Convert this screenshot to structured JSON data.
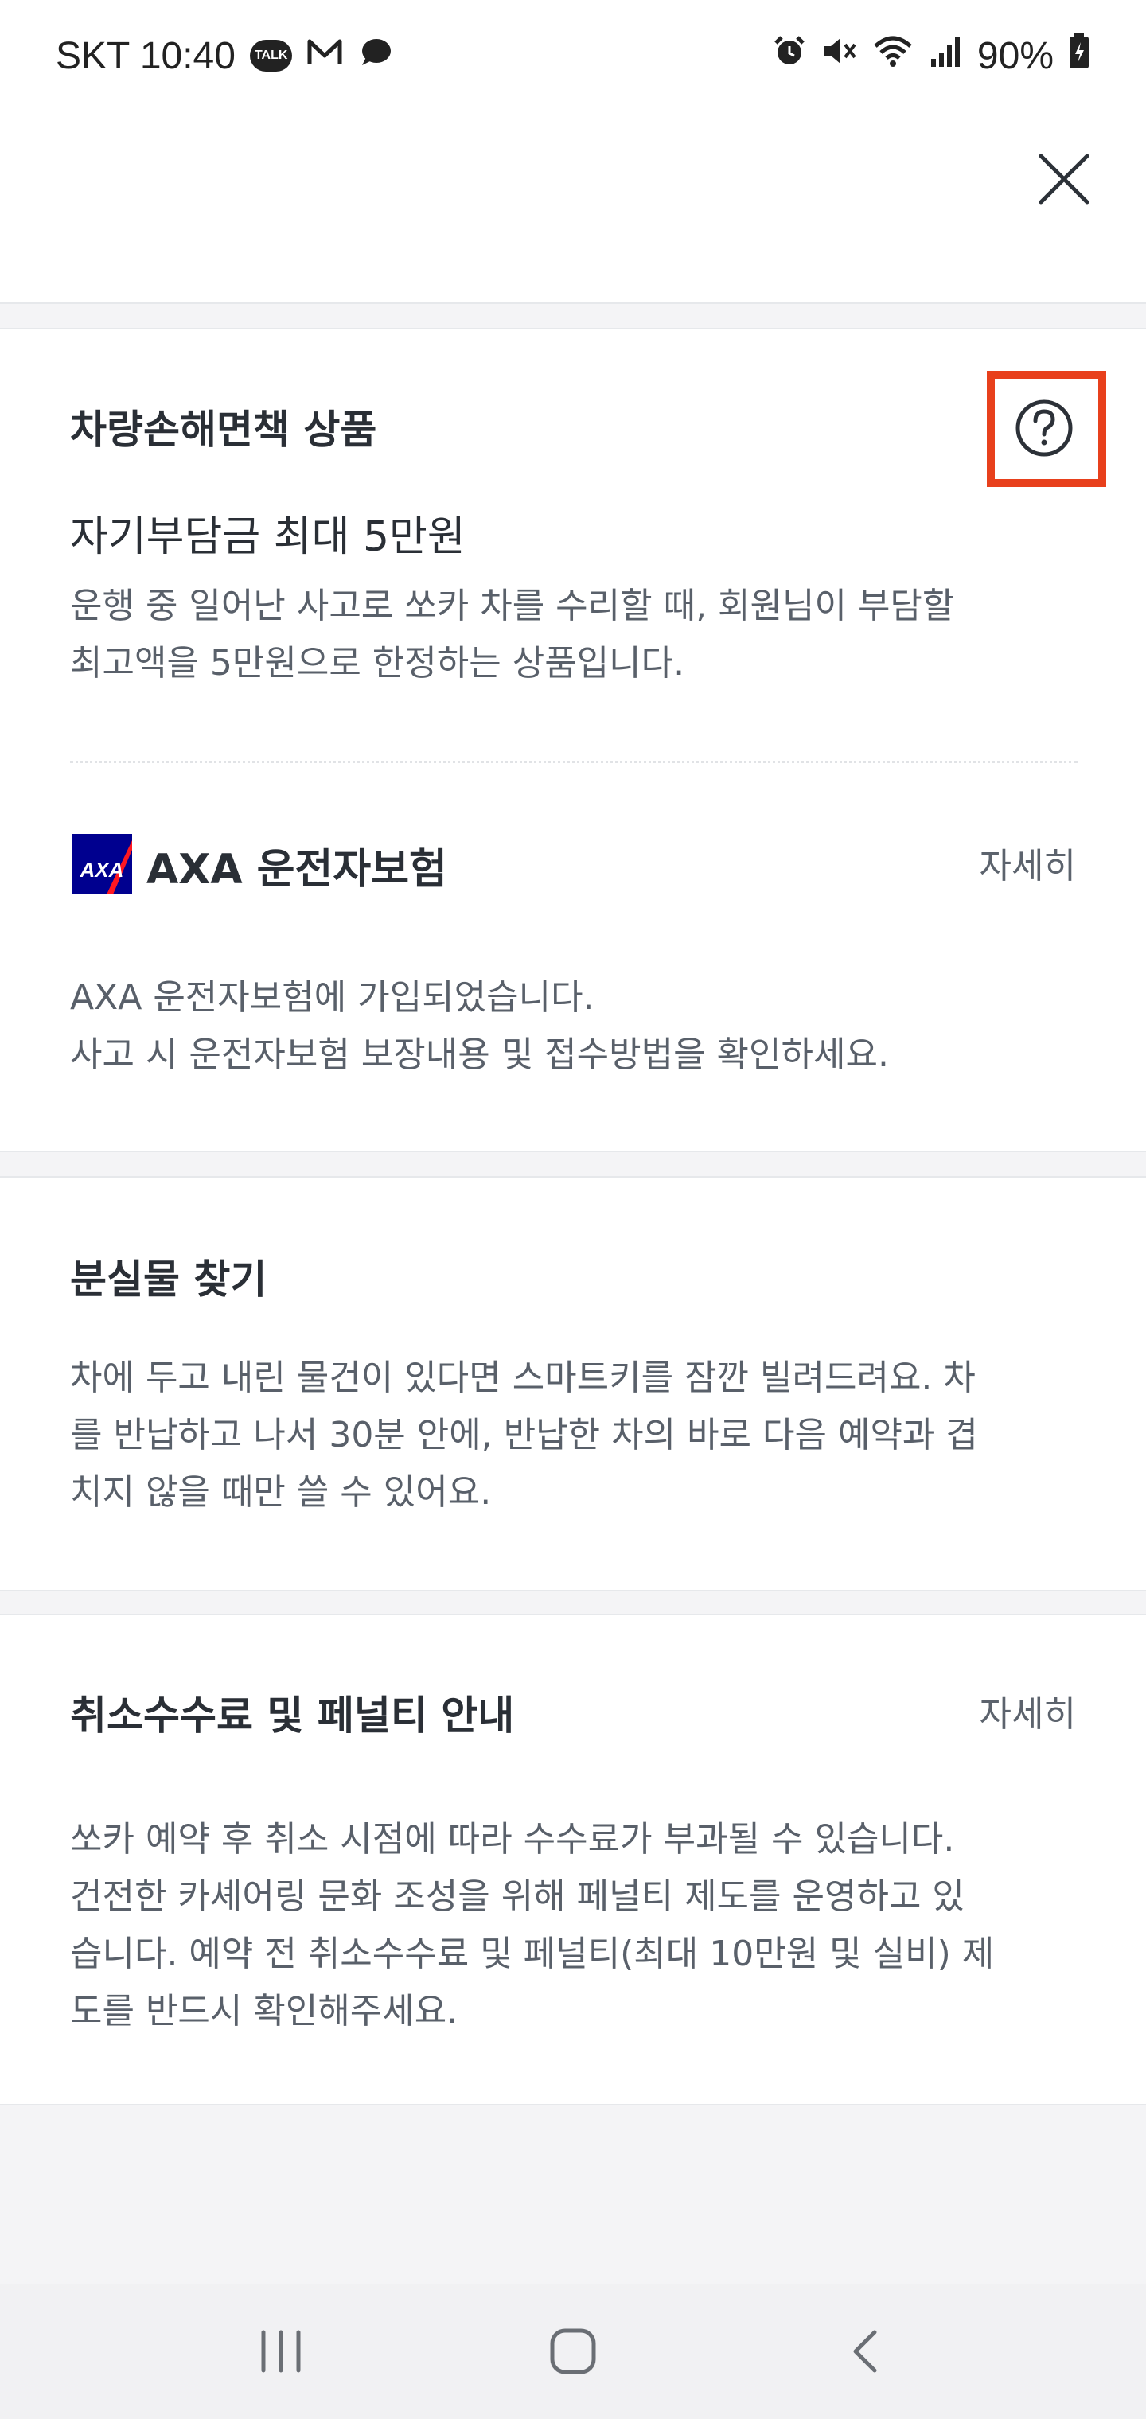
{
  "status_bar": {
    "carrier_time": "SKT 10:40",
    "talk_badge": "TALK",
    "battery": "90%",
    "icons": [
      "talk-icon",
      "mail-icon",
      "chat-bubble-icon",
      "alarm-icon",
      "mute-icon",
      "wifi-icon",
      "signal-icon",
      "battery-icon"
    ]
  },
  "header": {
    "close_icon": "close-icon"
  },
  "insurance_card": {
    "title": "차량손해면책 상품",
    "help_icon": "question-circle-icon",
    "plan_name": "자기부담금 최대 5만원",
    "description_lines": [
      "운행 중 일어난 사고로 쏘카 차를 수리할 때, 회원님이 부담할",
      "최고액을 5만원으로 한정하는 상품입니다."
    ],
    "axa": {
      "logo_text": "AXA",
      "title": "AXA 운전자보험",
      "detail_link": "자세히",
      "description_lines": [
        "AXA 운전자보험에 가입되었습니다.",
        "사고 시 운전자보험 보장내용 및 접수방법을 확인하세요."
      ]
    }
  },
  "lost_items_card": {
    "title": "분실물 찾기",
    "description_lines": [
      "차에 두고 내린 물건이 있다면 스마트키를 잠깐 빌려드려요. 차",
      "를 반납하고 나서 30분 안에, 반납한 차의 바로 다음 예약과 겹",
      "치지 않을 때만 쓸 수 있어요."
    ]
  },
  "cancel_card": {
    "title": "취소수수료 및 페널티 안내",
    "detail_link": "자세히",
    "description_lines": [
      "쏘카 예약 후 취소 시점에 따라 수수료가 부과될 수 있습니다.",
      "건전한 카셰어링 문화 조성을 위해 페널티 제도를 운영하고 있",
      "습니다. 예약 전 취소수수료 및 페널티(최대 10만원 및 실비) 제",
      "도를 반드시 확인해주세요."
    ]
  },
  "nav_bar": {
    "buttons": [
      "recent-apps-icon",
      "home-icon",
      "back-icon"
    ]
  },
  "colors": {
    "highlight": "#e8401c",
    "axa_blue": "#00008f",
    "axa_red": "#ff1721"
  }
}
